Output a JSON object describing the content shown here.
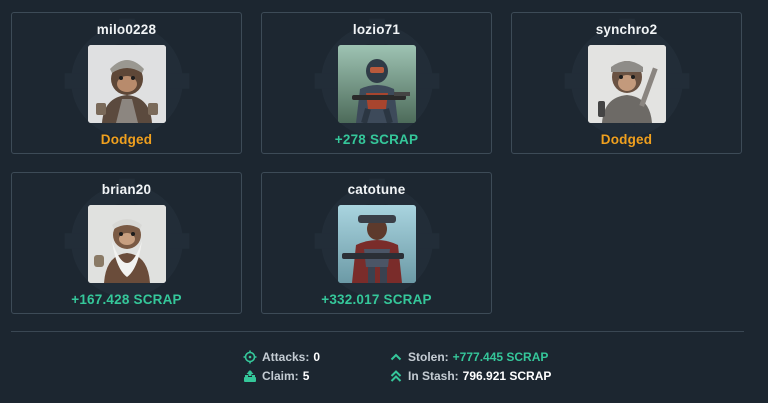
{
  "players": [
    {
      "name": "milo0228",
      "result": "Dodged",
      "result_type": "dodged",
      "avatar": "ape-soldier-avatar",
      "bg": "#dfe0e1"
    },
    {
      "name": "lozio71",
      "result": "+278 SCRAP",
      "result_type": "scrap",
      "avatar": "armored-rifleman-avatar",
      "bg": "#6f9a8c"
    },
    {
      "name": "synchro2",
      "result": "Dodged",
      "result_type": "dodged",
      "avatar": "ape-wrench-avatar",
      "bg": "#e3e3e1"
    },
    {
      "name": "brian20",
      "result": "+167.428 SCRAP",
      "result_type": "scrap",
      "avatar": "bearded-ape-avatar",
      "bg": "#e0e1df"
    },
    {
      "name": "catotune",
      "result": "+332.017 SCRAP",
      "result_type": "scrap",
      "avatar": "heavy-gunner-avatar",
      "bg": "#83b8c7"
    }
  ],
  "summary": {
    "attacks_label": "Attacks:",
    "attacks_value": "0",
    "claim_label": "Claim:",
    "claim_value": "5",
    "stolen_label": "Stolen:",
    "stolen_value": "+777.445 SCRAP",
    "stash_label": "In Stash:",
    "stash_value": "796.921 SCRAP"
  },
  "colors": {
    "dodged": "#f0a01e",
    "scrap": "#35c79a",
    "accent": "#35c79a"
  }
}
